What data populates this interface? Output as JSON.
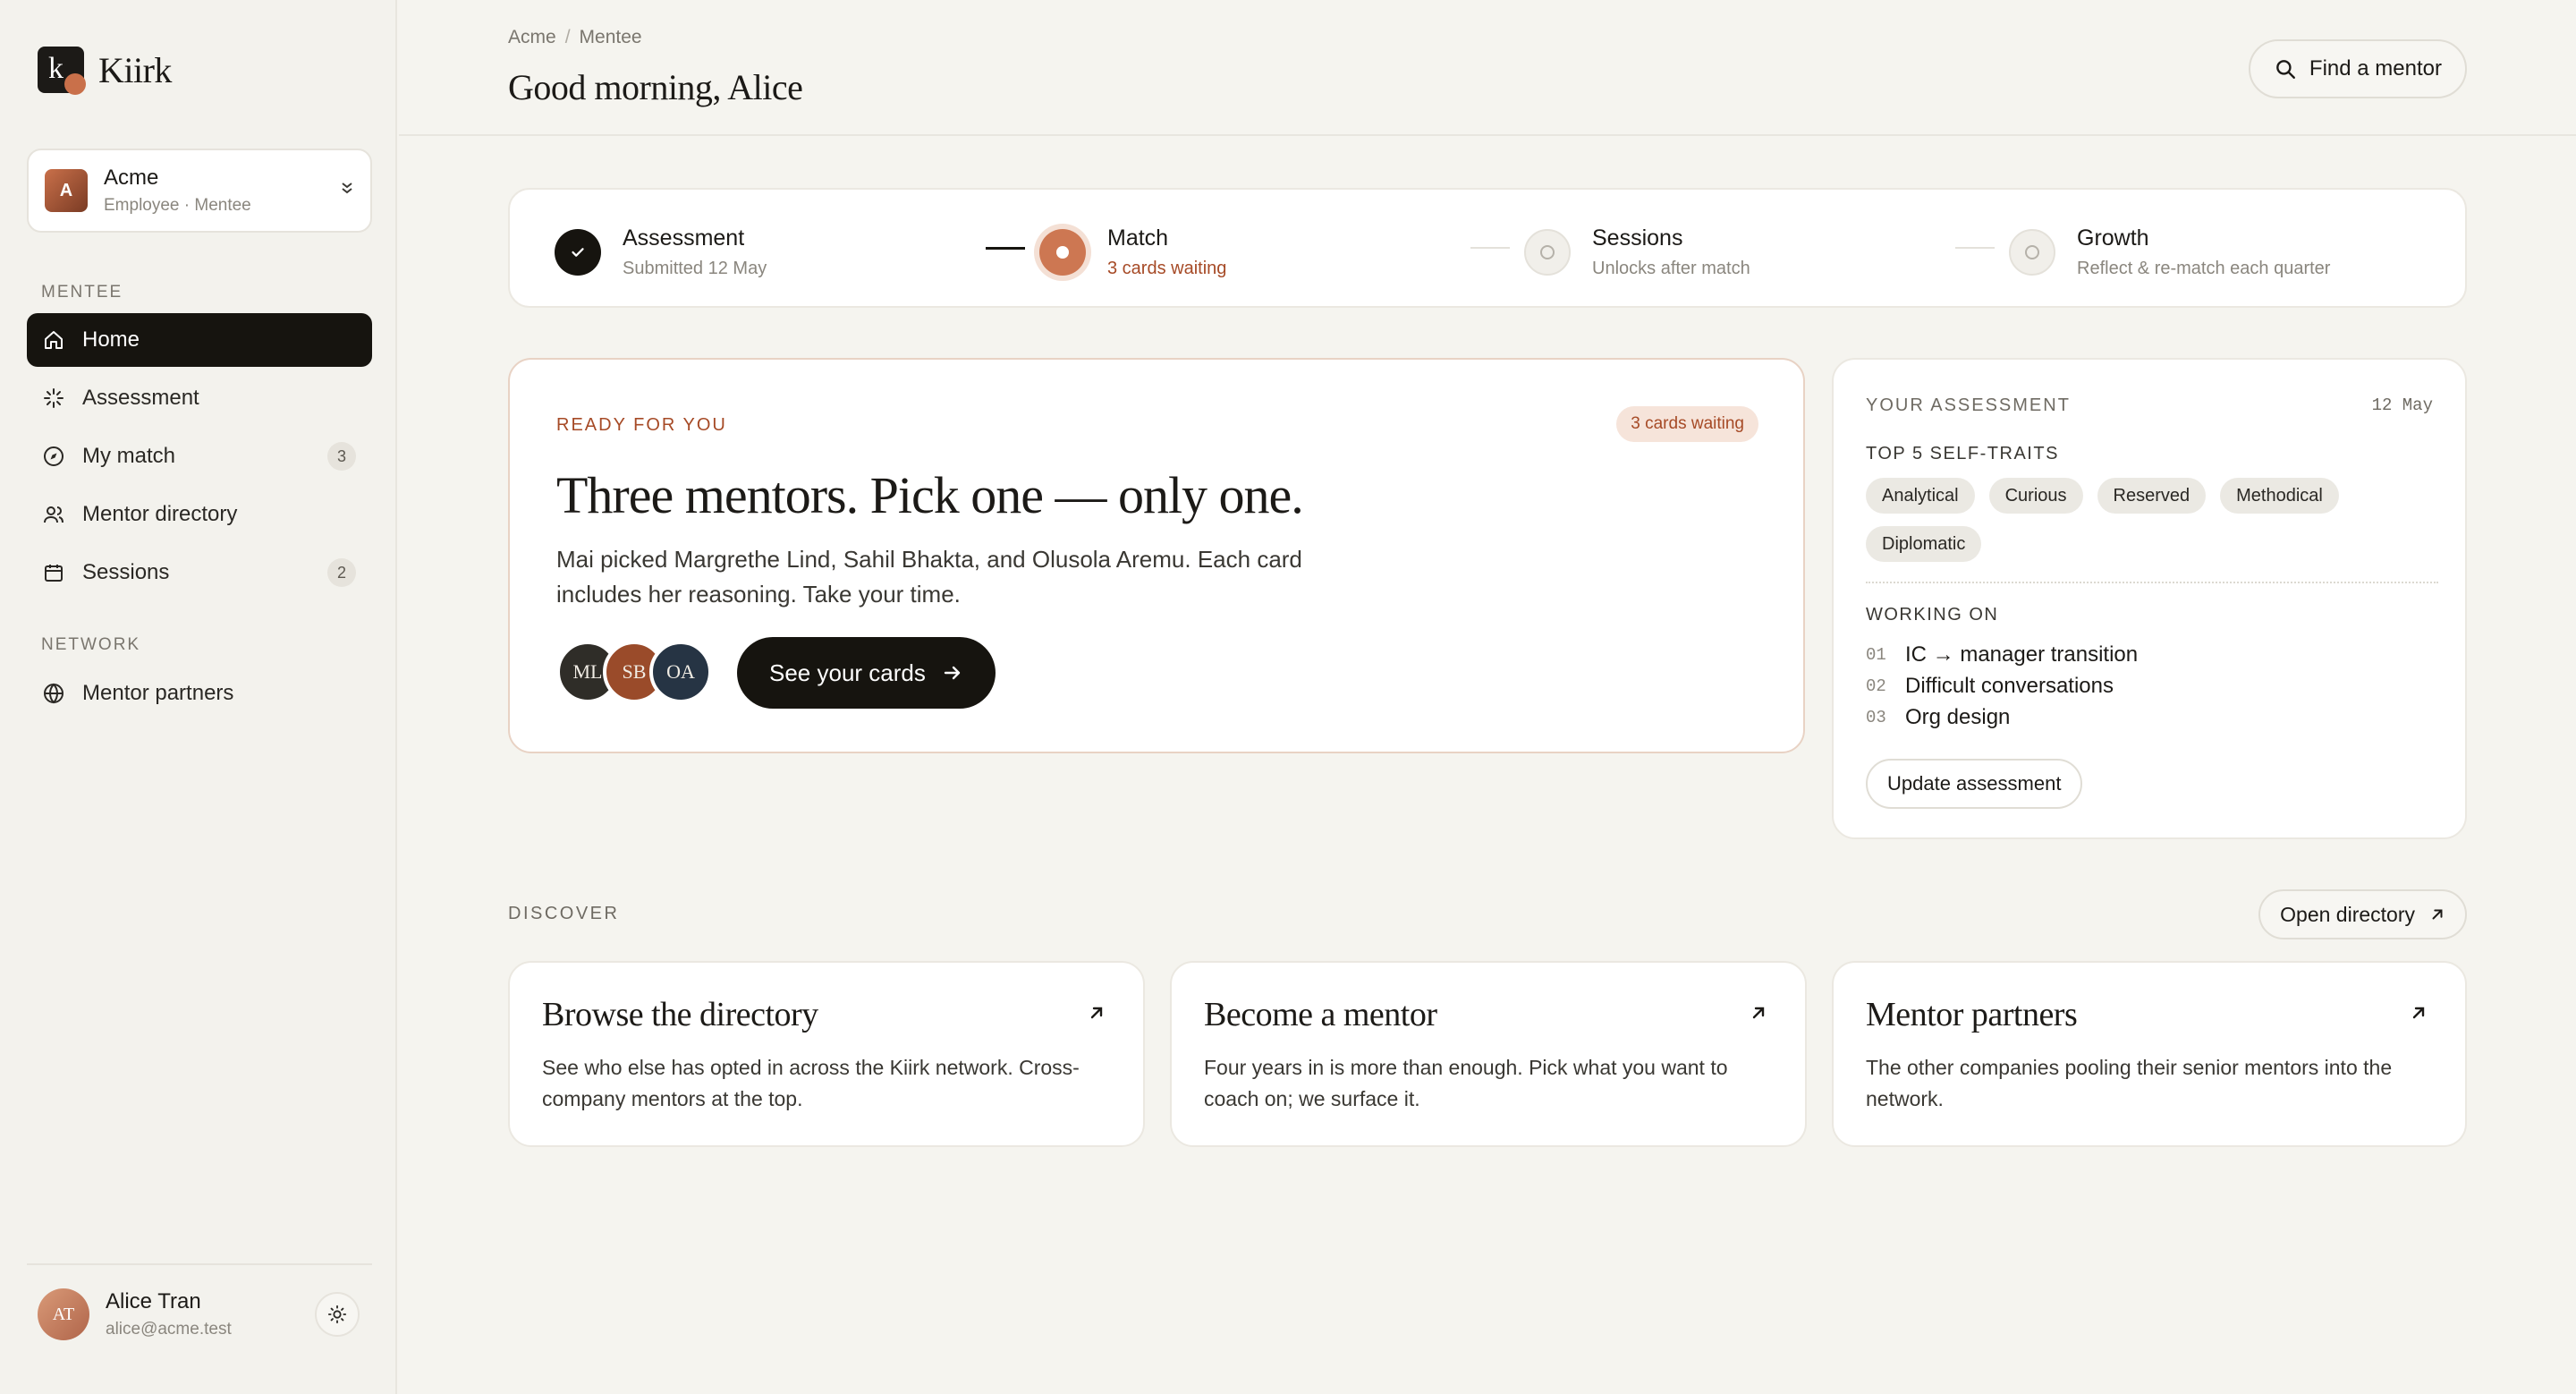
{
  "brand": {
    "name": "Kiirk",
    "mark": "k"
  },
  "org": {
    "avatar": "A",
    "name": "Acme",
    "role": "Employee · Mentee"
  },
  "nav": {
    "section_mentee": "MENTEE",
    "section_network": "NETWORK",
    "items": [
      {
        "label": "Home",
        "icon": "home-icon",
        "active": true
      },
      {
        "label": "Assessment",
        "icon": "spark-icon"
      },
      {
        "label": "My match",
        "icon": "compass-icon",
        "badge": "3"
      },
      {
        "label": "Mentor directory",
        "icon": "people-icon"
      },
      {
        "label": "Sessions",
        "icon": "calendar-icon",
        "badge": "2"
      },
      {
        "label": "Mentor partners",
        "icon": "globe-icon"
      }
    ]
  },
  "user": {
    "initials": "AT",
    "name": "Alice Tran",
    "email": "alice@acme.test"
  },
  "header": {
    "breadcrumb": [
      "Acme",
      "Mentee"
    ],
    "title": "Good morning, Alice",
    "find_button": "Find a mentor"
  },
  "steps": [
    {
      "title": "Assessment",
      "sub": "Submitted 12 May",
      "state": "done"
    },
    {
      "title": "Match",
      "sub": "3 cards waiting",
      "state": "current"
    },
    {
      "title": "Sessions",
      "sub": "Unlocks after match",
      "state": "pending"
    },
    {
      "title": "Growth",
      "sub": "Reflect & re-match each quarter",
      "state": "pending"
    }
  ],
  "ready": {
    "eyebrow": "READY FOR YOU",
    "pill": "3 cards waiting",
    "title": "Three mentors. Pick one — only one.",
    "body": "Mai picked Margrethe Lind, Sahil Bhakta, and Olusola Aremu. Each card includes her reasoning. Take your time.",
    "avatars": [
      {
        "initials": "ML",
        "color": "#2f2d28"
      },
      {
        "initials": "SB",
        "color": "#9a4b2a"
      },
      {
        "initials": "OA",
        "color": "#263444"
      }
    ],
    "cta": "See your cards"
  },
  "assessment": {
    "eyebrow": "YOUR ASSESSMENT",
    "date": "12 May",
    "traits_label": "TOP 5 SELF-TRAITS",
    "traits": [
      "Analytical",
      "Curious",
      "Reserved",
      "Methodical",
      "Diplomatic"
    ],
    "working_label": "WORKING ON",
    "working": [
      {
        "num": "01",
        "text": "IC → manager transition"
      },
      {
        "num": "02",
        "text": "Difficult conversations"
      },
      {
        "num": "03",
        "text": "Org design"
      }
    ],
    "update_button": "Update assessment"
  },
  "discover": {
    "label": "DISCOVER",
    "open_button": "Open directory",
    "cards": [
      {
        "title": "Browse the directory",
        "body": "See who else has opted in across the Kiirk network. Cross-company mentors at the top."
      },
      {
        "title": "Become a mentor",
        "body": "Four years in is more than enough. Pick what you want to coach on; we surface it."
      },
      {
        "title": "Mentor partners",
        "body": "The other companies pooling their senior mentors into the network."
      }
    ]
  },
  "colors": {
    "accent": "#cd7752",
    "accent_text": "#a64a26",
    "ink": "#16140f",
    "background": "#f5f4ef"
  }
}
